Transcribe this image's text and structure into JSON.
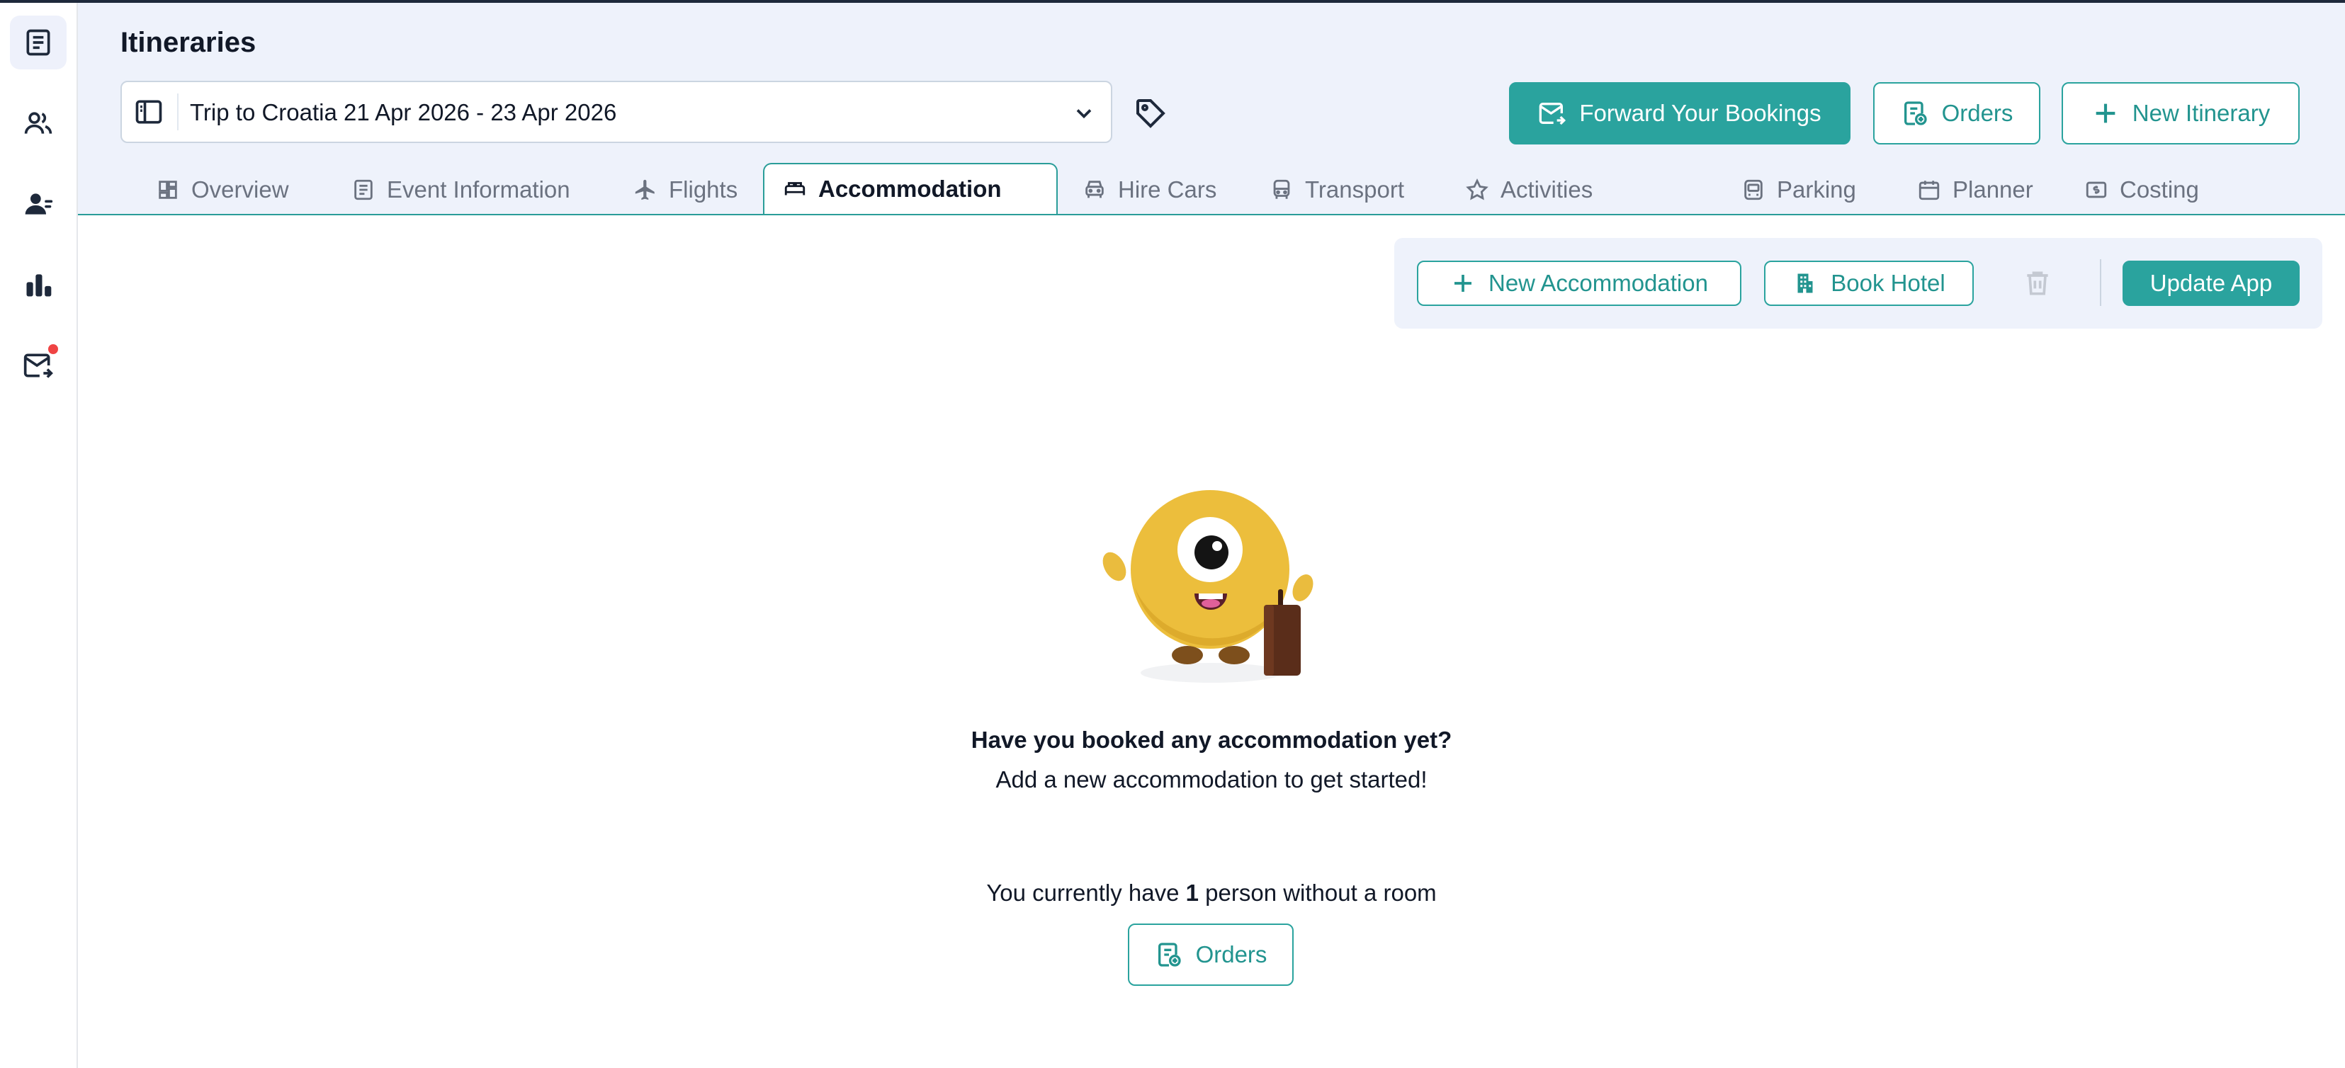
{
  "app": {
    "title": "Itineraries"
  },
  "sidebar": {
    "items": [
      {
        "icon": "itineraries-icon",
        "active": true
      },
      {
        "icon": "people-icon",
        "active": false
      },
      {
        "icon": "contacts-icon",
        "active": false
      },
      {
        "icon": "reports-icon",
        "active": false
      },
      {
        "icon": "mail-forward-icon",
        "active": false,
        "notification": true
      }
    ]
  },
  "header": {
    "trip_select_value": "Trip to Croatia 21 Apr 2026 - 23 Apr 2026",
    "forward_bookings_label": "Forward Your Bookings",
    "orders_label": "Orders",
    "new_itinerary_label": "New Itinerary"
  },
  "tabs": [
    {
      "label": "Overview",
      "icon": "overview-icon"
    },
    {
      "label": "Event Information",
      "icon": "document-icon"
    },
    {
      "label": "Flights",
      "icon": "plane-icon"
    },
    {
      "label": "Accommodation",
      "icon": "bed-icon",
      "active": true
    },
    {
      "label": "Hire Cars",
      "icon": "car-icon"
    },
    {
      "label": "Transport",
      "icon": "bus-icon"
    },
    {
      "label": "Activities",
      "icon": "star-icon"
    },
    {
      "label": "Parking",
      "icon": "parking-icon"
    },
    {
      "label": "Planner",
      "icon": "calendar-icon"
    },
    {
      "label": "Costing",
      "icon": "costing-icon"
    }
  ],
  "actions": {
    "new_accommodation_label": "New Accommodation",
    "book_hotel_label": "Book Hotel",
    "update_app_label": "Update App"
  },
  "empty_state": {
    "heading": "Have you booked any accommodation yet?",
    "subtext": "Add a new accommodation to get started!",
    "rooms_prefix": "You currently have",
    "rooms_count": "1",
    "rooms_suffix": "person without a room",
    "orders_label": "Orders"
  },
  "colors": {
    "accent": "#2aa39e",
    "header_bg": "#eef2fb",
    "notification": "#ef4444"
  }
}
